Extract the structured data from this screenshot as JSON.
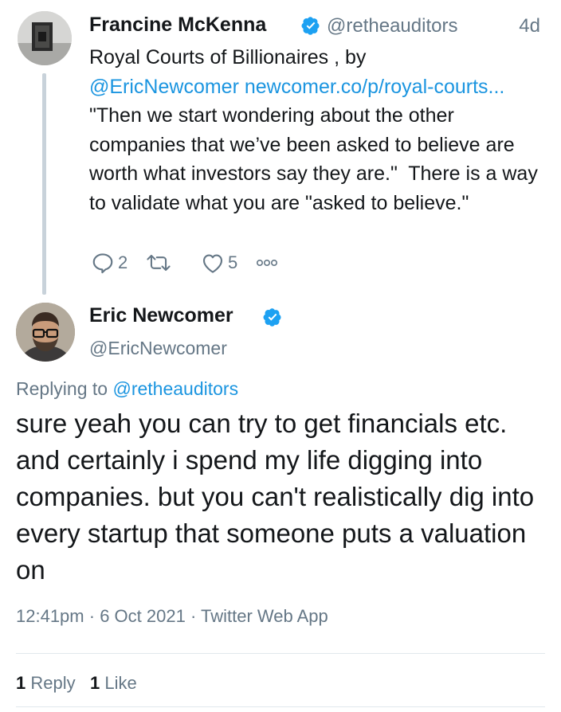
{
  "parent_tweet": {
    "author_name": "Francine McKenna",
    "author_handle": "@retheauditors",
    "time_ago": "4d",
    "text_line1": "Royal Courts of Billionaires , by",
    "mention": "@EricNewcomer",
    "link": "newcomer.co/p/royal-courts...",
    "text_rest": " \"Then we start wondering about the other companies that we’ve been asked to believe are worth what investors say they are.\"  There is a way to validate what you are \"asked to believe.\"",
    "reply_count": "2",
    "like_count": "5"
  },
  "main_tweet": {
    "author_name": "Eric Newcomer",
    "author_handle": "@EricNewcomer",
    "replying_prefix": "Replying to",
    "replying_handle": "@retheauditors",
    "text": "sure yeah you can try to get financials etc. and certainly i spend my life digging into companies. but you can't realistically dig into every startup that someone puts a valuation on",
    "time": "12:41pm",
    "date": "6 Oct 2021",
    "source": "Twitter Web App",
    "replies_count": "1",
    "replies_label": "Reply",
    "likes_count": "1",
    "likes_label": "Like"
  },
  "colors": {
    "link": "#1b95e0",
    "secondary_text": "#657786",
    "primary_text": "#14171a",
    "verified_badge": "#1da1f2"
  },
  "icons": [
    "reply-icon",
    "retweet-icon",
    "like-icon",
    "more-icon",
    "verified-badge-icon"
  ]
}
